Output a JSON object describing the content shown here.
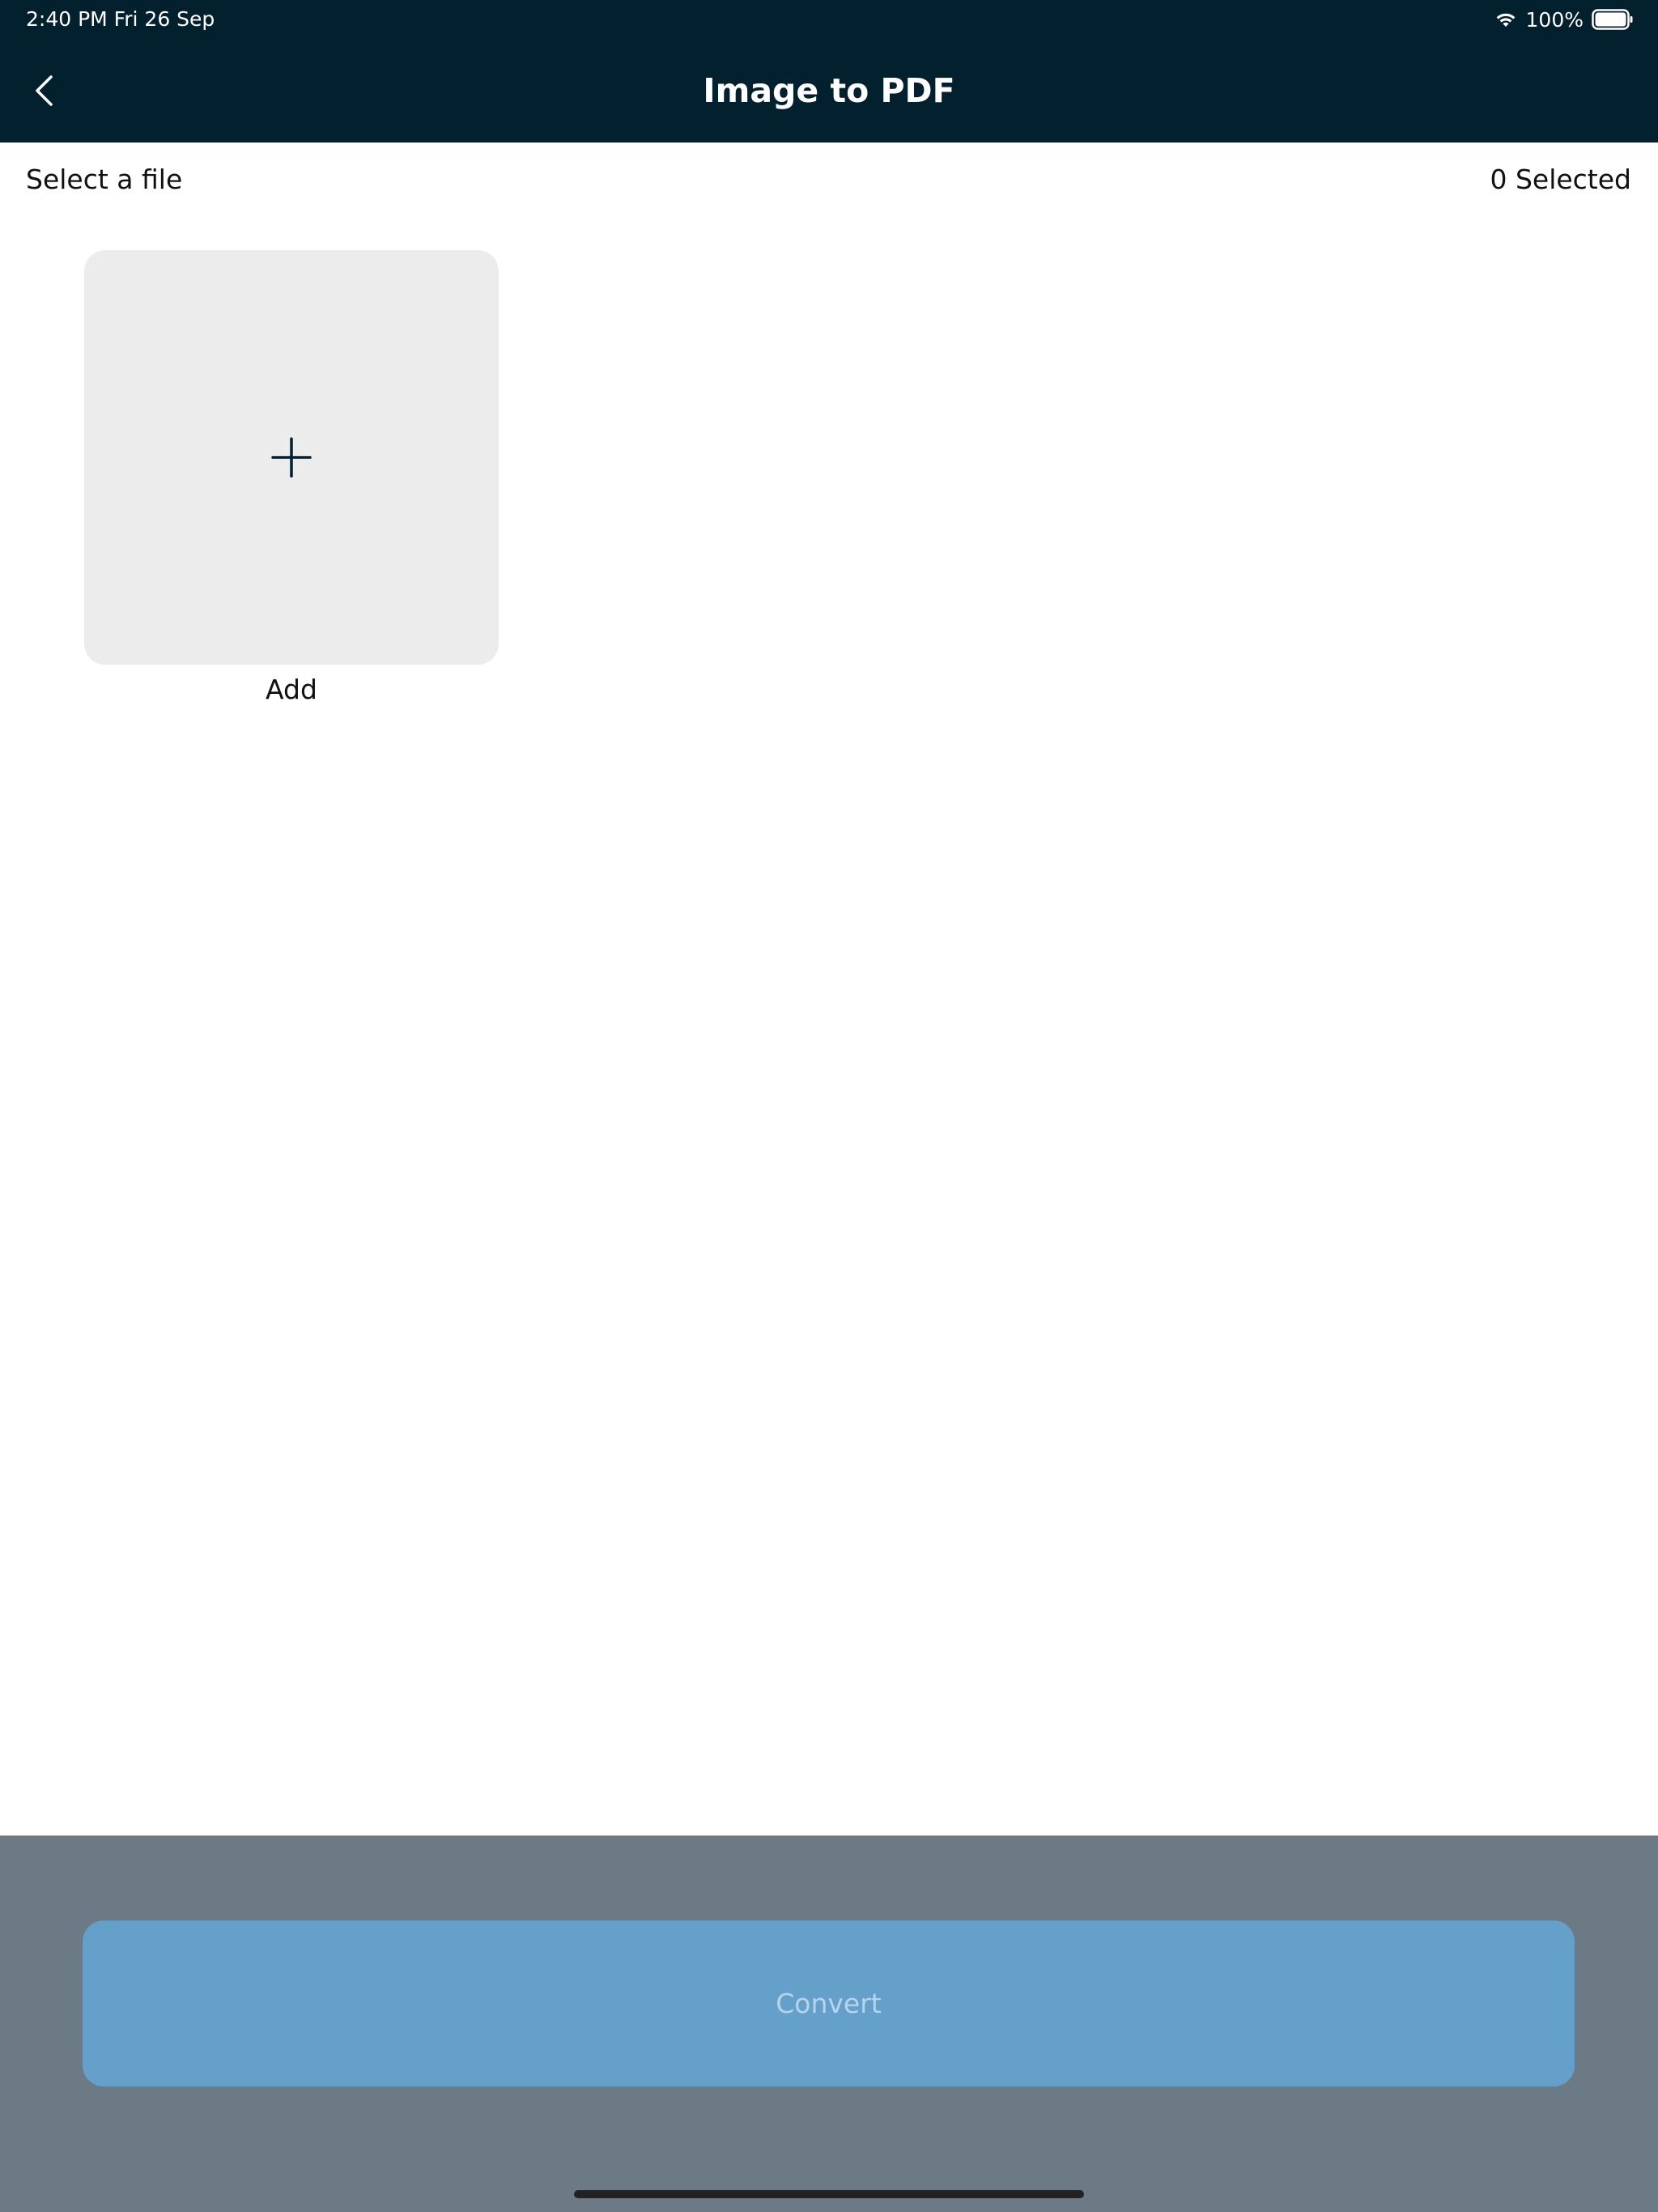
{
  "status_bar": {
    "time_date": "2:40 PM   Fri 26 Sep",
    "battery_text": "100%"
  },
  "nav": {
    "title": "Image to PDF",
    "back_icon": "chevron-left-icon"
  },
  "selection": {
    "prompt": "Select a file",
    "count_text": "0 Selected"
  },
  "add_tile": {
    "label": "Add",
    "icon": "plus-icon"
  },
  "actions": {
    "convert_label": "Convert"
  },
  "colors": {
    "header_bg": "#03202f",
    "tile_bg": "#ececec",
    "overlay_bg": "#6b7a84",
    "button_bg": "#65a0cb",
    "button_text": "#b6d3ea"
  }
}
